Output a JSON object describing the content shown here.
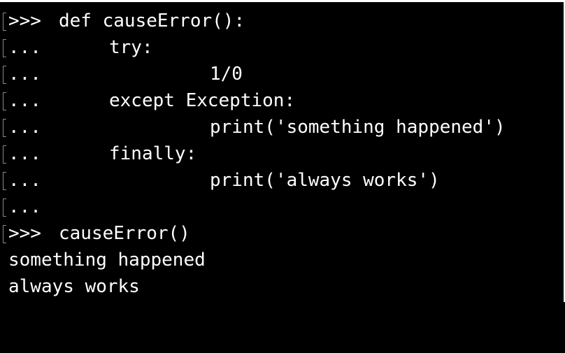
{
  "terminal": {
    "lines": [
      {
        "prompt": ">>>",
        "code": "def causeError():"
      },
      {
        "prompt": "...",
        "code": "try:"
      },
      {
        "prompt": "...",
        "code": "1/0"
      },
      {
        "prompt": "...",
        "code": "except Exception:"
      },
      {
        "prompt": "...",
        "code": "print('something happened')"
      },
      {
        "prompt": "...",
        "code": "finally:"
      },
      {
        "prompt": "...",
        "code": "print('always works')"
      },
      {
        "prompt": "...",
        "code": ""
      },
      {
        "prompt": ">>>",
        "code": "causeError()"
      }
    ],
    "output": [
      "something happened",
      "always works"
    ]
  }
}
